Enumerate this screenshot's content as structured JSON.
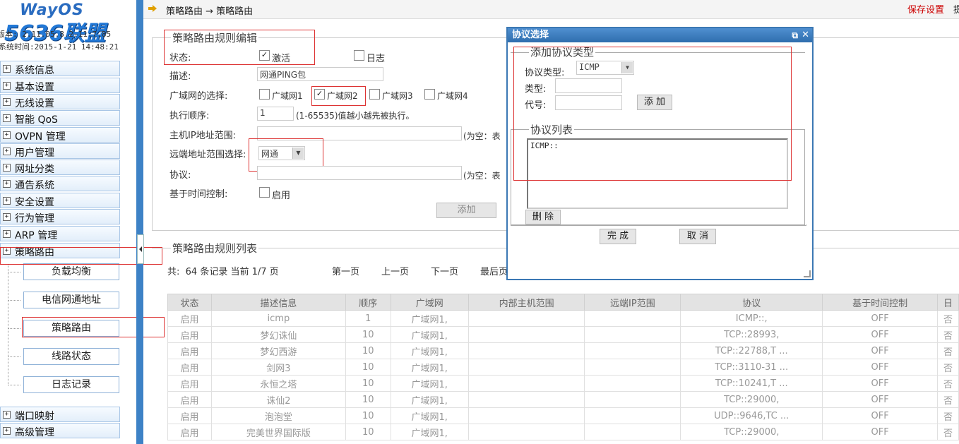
{
  "logo": {
    "brand": "WayOS",
    "site": "5636联盟",
    "version_line": "版本: 2.11.05.8.2.11.7.85",
    "time_line": "系统时间:2015-1-21 14:48:21"
  },
  "sidebar": {
    "items": [
      {
        "label": "系统信息"
      },
      {
        "label": "基本设置"
      },
      {
        "label": "无线设置"
      },
      {
        "label": "智能 QoS"
      },
      {
        "label": "OVPN 管理"
      },
      {
        "label": "用户管理"
      },
      {
        "label": "网址分类"
      },
      {
        "label": "通告系统"
      },
      {
        "label": "安全设置"
      },
      {
        "label": "行为管理"
      },
      {
        "label": "ARP 管理"
      },
      {
        "label": "策略路由"
      }
    ],
    "sub_items": [
      {
        "label": "负载均衡"
      },
      {
        "label": "电信网通地址"
      },
      {
        "label": "策略路由"
      },
      {
        "label": "线路状态"
      },
      {
        "label": "日志记录"
      }
    ],
    "bottom_items": [
      {
        "label": "端口映射"
      },
      {
        "label": "高级管理"
      }
    ]
  },
  "topbar": {
    "crumb": "策略路由 → 策略路由",
    "save": "保存设置"
  },
  "edit": {
    "title": "策略路由规则编辑",
    "status_label": "状态:",
    "active_label": "激活",
    "log_label": "日志",
    "desc_label": "描述:",
    "desc_value": "网通PING包",
    "wan_label": "广域网的选择:",
    "wan1": "广域网1",
    "wan2": "广域网2",
    "wan3": "广域网3",
    "wan4": "广域网4",
    "order_label": "执行顺序:",
    "order_value": "1",
    "order_hint": "(1-65535)值越小越先被执行。",
    "host_label": "主机IP地址范围:",
    "host_hint": "(为空：表",
    "remote_label": "远端地址范围选择:",
    "remote_value": "网通",
    "proto_label": "协议:",
    "proto_hint": "(为空：表",
    "time_label": "基于时间控制:",
    "time_enable": "启用",
    "add_button": "添加"
  },
  "list": {
    "title": "策略路由规则列表",
    "summary": "共:  64 条记录 当前 1/7 页",
    "first": "第一页",
    "prev": "上一页",
    "next": "下一页",
    "last": "最后页",
    "headers": [
      "状态",
      "描述信息",
      "顺序",
      "广域网",
      "内部主机范围",
      "远端IP范围",
      "协议",
      "基于时间控制",
      "日"
    ],
    "rows": [
      [
        "启用",
        "icmp",
        "1",
        "广域网1,",
        "",
        "",
        "ICMP::,",
        "OFF",
        "否"
      ],
      [
        "启用",
        "梦幻诛仙",
        "10",
        "广域网1,",
        "",
        "",
        "TCP::28993,",
        "OFF",
        "否"
      ],
      [
        "启用",
        "梦幻西游",
        "10",
        "广域网1,",
        "",
        "",
        "TCP::22788,T ...",
        "OFF",
        "否"
      ],
      [
        "启用",
        "剑网3",
        "10",
        "广域网1,",
        "",
        "",
        "TCP::3110-31 ...",
        "OFF",
        "否"
      ],
      [
        "启用",
        "永恒之塔",
        "10",
        "广域网1,",
        "",
        "",
        "TCP::10241,T ...",
        "OFF",
        "否"
      ],
      [
        "启用",
        "诛仙2",
        "10",
        "广域网1,",
        "",
        "",
        "TCP::29000,",
        "OFF",
        "否"
      ],
      [
        "启用",
        "泡泡堂",
        "10",
        "广域网1,",
        "",
        "",
        "UDP::9646,TC ...",
        "OFF",
        "否"
      ],
      [
        "启用",
        "完美世界国际版",
        "10",
        "广域网1,",
        "",
        "",
        "TCP::29000,",
        "OFF",
        "否"
      ]
    ]
  },
  "dialog": {
    "title": "协议选择",
    "add_section": "添加协议类型",
    "proto_type_label": "协议类型:",
    "proto_type_value": "ICMP",
    "type_label": "类型:",
    "code_label": "代号:",
    "add_button": "添 加",
    "list_section": "协议列表",
    "list_value": "ICMP::",
    "delete_button": "删 除",
    "done_button": "完 成",
    "cancel_button": "取 消"
  },
  "colors": {
    "accent": "#3b78b4",
    "highlight": "#d33333",
    "save": "#cc0000"
  }
}
